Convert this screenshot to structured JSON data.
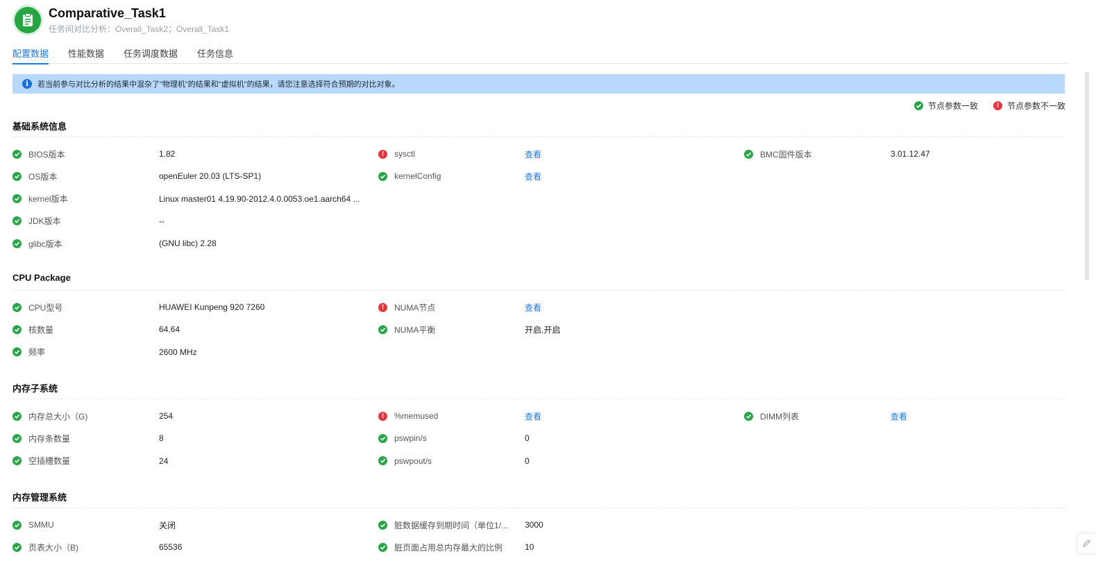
{
  "header": {
    "title": "Comparative_Task1",
    "subtitle": "任务间对比分析：Overall_Task2；Overall_Task1",
    "icon": "clipboard-icon",
    "accent": "#26a542"
  },
  "tabs": [
    {
      "label": "配置数据",
      "active": true
    },
    {
      "label": "性能数据",
      "active": false
    },
    {
      "label": "任务调度数据",
      "active": false
    },
    {
      "label": "任务信息",
      "active": false
    }
  ],
  "alert": {
    "text": "若当前参与对比分析的结果中混杂了\"物理机\"的结果和\"虚拟机\"的结果，请您注意选择符合预期的对比对象。",
    "icon": "info-icon"
  },
  "legend": {
    "consistent": "节点参数一致",
    "inconsistent": "节点参数不一致"
  },
  "colors": {
    "ok": "#2aa54a",
    "bad": "#e0383e",
    "link": "#1f7ae0"
  },
  "sections": [
    {
      "title": "基础系统信息",
      "rows": [
        [
          {
            "label": "BIOS版本",
            "value": "1.82",
            "status": "ok"
          },
          {
            "label": "sysctl",
            "value": "查看",
            "status": "bad",
            "link": true
          },
          {
            "label": "BMC固件版本",
            "value": "3.01.12.47",
            "status": "ok"
          }
        ],
        [
          {
            "label": "OS版本",
            "value": "openEuler 20.03 (LTS-SP1)",
            "status": "ok"
          },
          {
            "label": "kernelConfig",
            "value": "查看",
            "status": "ok",
            "link": true
          }
        ],
        [
          {
            "label": "kernel版本",
            "value": "Linux master01 4.19.90-2012.4.0.0053.oe1.aarch64 ...",
            "status": "ok"
          }
        ],
        [
          {
            "label": "JDK版本",
            "value": "--",
            "status": "ok"
          }
        ],
        [
          {
            "label": "glibc版本",
            "value": "(GNU libc) 2.28",
            "status": "ok"
          }
        ]
      ]
    },
    {
      "title": "CPU Package",
      "rows": [
        [
          {
            "label": "CPU型号",
            "value": "HUAWEI Kunpeng 920 7260",
            "status": "ok"
          },
          {
            "label": "NUMA节点",
            "value": "查看",
            "status": "bad",
            "link": true
          }
        ],
        [
          {
            "label": "核数量",
            "value": "64,64",
            "status": "ok"
          },
          {
            "label": "NUMA平衡",
            "value": "开启,开启",
            "status": "ok"
          }
        ],
        [
          {
            "label": "频率",
            "value": "2600 MHz",
            "status": "ok"
          }
        ]
      ]
    },
    {
      "title": "内存子系统",
      "rows": [
        [
          {
            "label": "内存总大小（G)",
            "value": "254",
            "status": "ok"
          },
          {
            "label": "%memused",
            "value": "查看",
            "status": "bad",
            "link": true
          },
          {
            "label": "DIMM列表",
            "value": "查看",
            "status": "ok",
            "link": true
          }
        ],
        [
          {
            "label": "内存条数量",
            "value": "8",
            "status": "ok"
          },
          {
            "label": "pswpin/s",
            "value": "0",
            "status": "ok"
          }
        ],
        [
          {
            "label": "空插槽数量",
            "value": "24",
            "status": "ok"
          },
          {
            "label": "pswpout/s",
            "value": "0",
            "status": "ok"
          }
        ]
      ]
    },
    {
      "title": "内存管理系统",
      "rows": [
        [
          {
            "label": "SMMU",
            "value": "关闭",
            "status": "ok"
          },
          {
            "label": "脏数据缓存到期时间（单位1/...",
            "value": "3000",
            "status": "ok"
          }
        ],
        [
          {
            "label": "页表大小（B)",
            "value": "65536",
            "status": "ok"
          },
          {
            "label": "脏页面占用总内存最大的比例",
            "value": "10",
            "status": "ok"
          }
        ]
      ]
    }
  ]
}
